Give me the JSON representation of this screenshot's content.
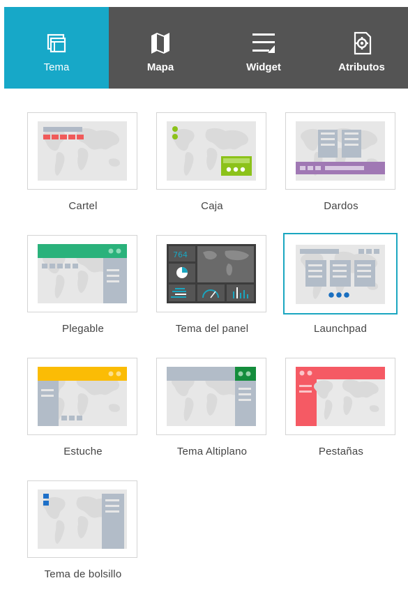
{
  "tabs": [
    {
      "label": "Tema",
      "icon": "theme-icon",
      "active": true
    },
    {
      "label": "Mapa",
      "icon": "map-icon",
      "active": false
    },
    {
      "label": "Widget",
      "icon": "widget-icon",
      "active": false
    },
    {
      "label": "Atributos",
      "icon": "attributes-icon",
      "active": false
    }
  ],
  "themes": [
    {
      "label": "Cartel",
      "icon": "billboard-theme-thumbnail"
    },
    {
      "label": "Caja",
      "icon": "box-theme-thumbnail"
    },
    {
      "label": "Dardos",
      "icon": "dart-theme-thumbnail"
    },
    {
      "label": "Plegable",
      "icon": "foldable-theme-thumbnail"
    },
    {
      "label": "Tema del panel",
      "icon": "dashboard-theme-thumbnail",
      "counter": "764"
    },
    {
      "label": "Launchpad",
      "icon": "launchpad-theme-thumbnail",
      "selected": true
    },
    {
      "label": "Estuche",
      "icon": "jewelry-box-theme-thumbnail"
    },
    {
      "label": "Tema Altiplano",
      "icon": "plateau-theme-thumbnail"
    },
    {
      "label": "Pestañas",
      "icon": "tab-theme-thumbnail"
    },
    {
      "label": "Tema de bolsillo",
      "icon": "pocket-theme-thumbnail"
    }
  ],
  "colors": {
    "tab_bar": "#545454",
    "tab_active": "#17a8c8",
    "selected_border": "#1aa6c0",
    "cartel_red": "#f05a5a",
    "caja_green": "#8cc21a",
    "dardos_purple": "#a078b4",
    "plegable_green": "#2ab27b",
    "launchpad_blue": "#1a6fc0",
    "estuche_yellow": "#fbbc05",
    "altiplano_green": "#148d3c",
    "pestanas_red": "#f55a64",
    "bolsillo_blue": "#1e70c8",
    "panel_slate": "#b2bcc8"
  }
}
